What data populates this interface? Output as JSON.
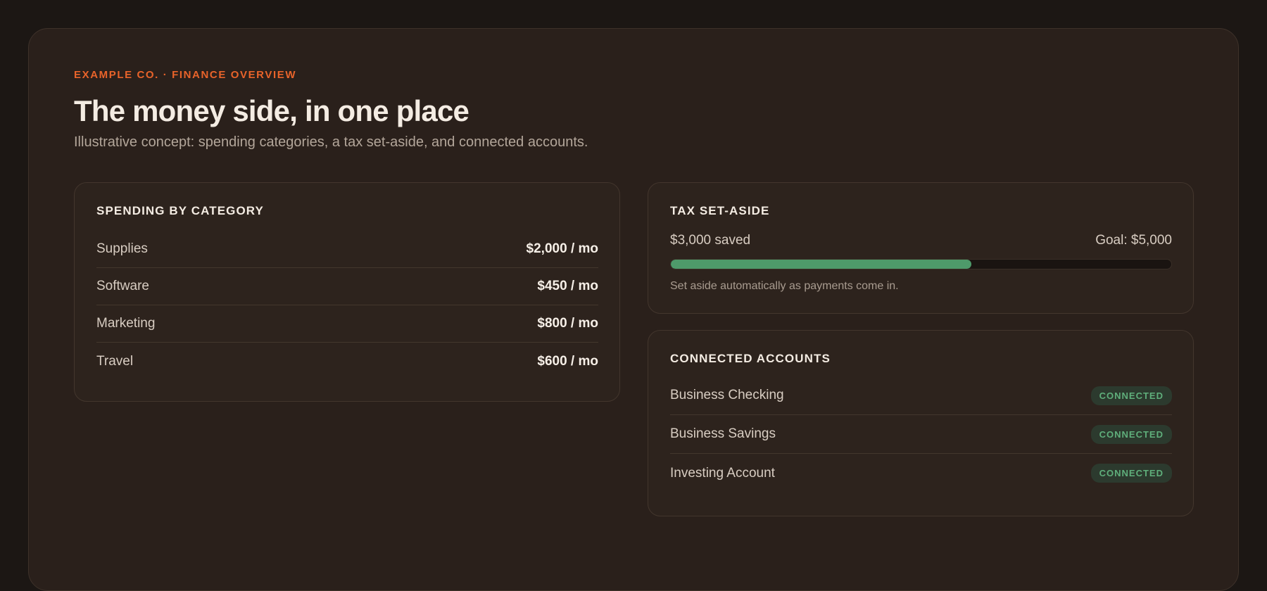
{
  "header": {
    "eyebrow": "EXAMPLE CO. · FINANCE OVERVIEW",
    "title": "The money side, in one place",
    "subtitle": "Illustrative concept: spending categories, a tax set-aside, and connected accounts."
  },
  "spending": {
    "title": "SPENDING BY CATEGORY",
    "items": [
      {
        "label": "Supplies",
        "value": "$2,000 / mo"
      },
      {
        "label": "Software",
        "value": "$450 / mo"
      },
      {
        "label": "Marketing",
        "value": "$800 / mo"
      },
      {
        "label": "Travel",
        "value": "$600 / mo"
      }
    ]
  },
  "tax": {
    "title": "TAX SET-ASIDE",
    "saved_label": "$3,000 saved",
    "goal_label": "Goal: $5,000",
    "progress_fraction": 0.6,
    "note": "Set aside automatically as payments come in."
  },
  "accounts": {
    "title": "CONNECTED ACCOUNTS",
    "items": [
      {
        "name": "Business Checking",
        "status": "CONNECTED"
      },
      {
        "name": "Business Savings",
        "status": "CONNECTED"
      },
      {
        "name": "Investing Account",
        "status": "CONNECTED"
      }
    ]
  },
  "colors": {
    "accent": "#e8632a",
    "progress": "#4e9a6a",
    "connected": "#5fae7b"
  }
}
